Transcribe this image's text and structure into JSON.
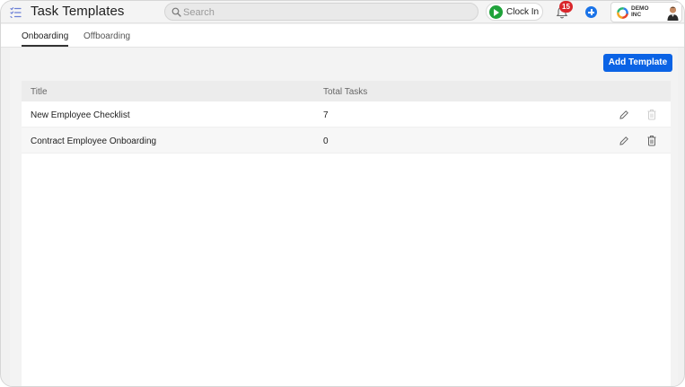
{
  "header": {
    "title": "Task Templates",
    "search_placeholder": "Search",
    "clock_in_label": "Clock In",
    "notification_count": "15",
    "company_name_line1": "DEMO",
    "company_name_line2": "INC"
  },
  "tabs": [
    {
      "label": "Onboarding",
      "active": true
    },
    {
      "label": "Offboarding",
      "active": false
    }
  ],
  "toolbar": {
    "add_template_label": "Add Template"
  },
  "table": {
    "columns": [
      "Title",
      "Total Tasks"
    ],
    "rows": [
      {
        "title": "New Employee Checklist",
        "total_tasks": "7",
        "delete_enabled": false
      },
      {
        "title": "Contract Employee Onboarding",
        "total_tasks": "0",
        "delete_enabled": true
      }
    ]
  },
  "colors": {
    "accent": "#0b63e5",
    "clock_in_green": "#1fa23a",
    "badge_red": "#d9262b"
  },
  "icons": {
    "app": "task-list-icon",
    "search": "search-icon",
    "clock_in": "play-icon",
    "notifications": "bell-icon",
    "quick_add": "plus-circle-icon",
    "edit": "pencil-icon",
    "delete": "trash-icon"
  }
}
